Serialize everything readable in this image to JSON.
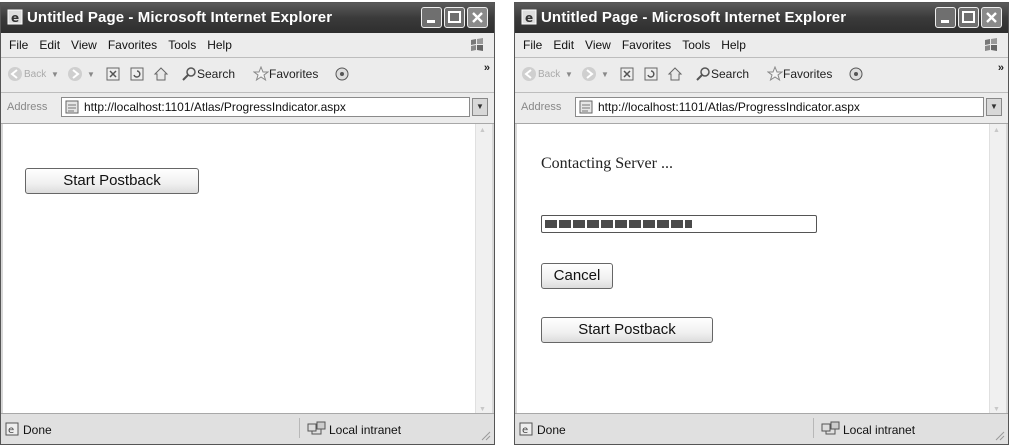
{
  "window_left": {
    "title": "Untitled Page - Microsoft Internet Explorer",
    "menu": [
      "File",
      "Edit",
      "View",
      "Favorites",
      "Tools",
      "Help"
    ],
    "toolbar": {
      "back_label": "Back",
      "search_label": "Search",
      "favorites_label": "Favorites"
    },
    "address": {
      "label": "Address",
      "url": "http://localhost:1101/Atlas/ProgressIndicator.aspx"
    },
    "content": {
      "start_button_label": "Start Postback"
    },
    "status": {
      "left": "Done",
      "zone": "Local intranet"
    }
  },
  "window_right": {
    "title": "Untitled Page - Microsoft Internet Explorer",
    "menu": [
      "File",
      "Edit",
      "View",
      "Favorites",
      "Tools",
      "Help"
    ],
    "toolbar": {
      "back_label": "Back",
      "search_label": "Search",
      "favorites_label": "Favorites"
    },
    "address": {
      "label": "Address",
      "url": "http://localhost:1101/Atlas/ProgressIndicator.aspx"
    },
    "content": {
      "status_text": "Contacting Server ...",
      "progress_fraction": 0.55,
      "cancel_button_label": "Cancel",
      "start_button_label": "Start Postback"
    },
    "status": {
      "left": "Done",
      "zone": "Local intranet"
    }
  },
  "icons": {
    "app": "internet-explorer-icon",
    "back": "back-arrow-icon",
    "forward": "forward-arrow-icon",
    "stop": "stop-icon",
    "refresh": "refresh-icon",
    "home": "home-icon",
    "search": "search-icon",
    "favorites": "star-icon",
    "media": "media-icon",
    "page": "page-icon",
    "zone": "local-intranet-icon",
    "windows_flag": "windows-flag-icon"
  },
  "colors": {
    "titlebar": "#3a3a3a",
    "content_bg": "#ffffff",
    "progress_fill": "#4a4a4a"
  }
}
